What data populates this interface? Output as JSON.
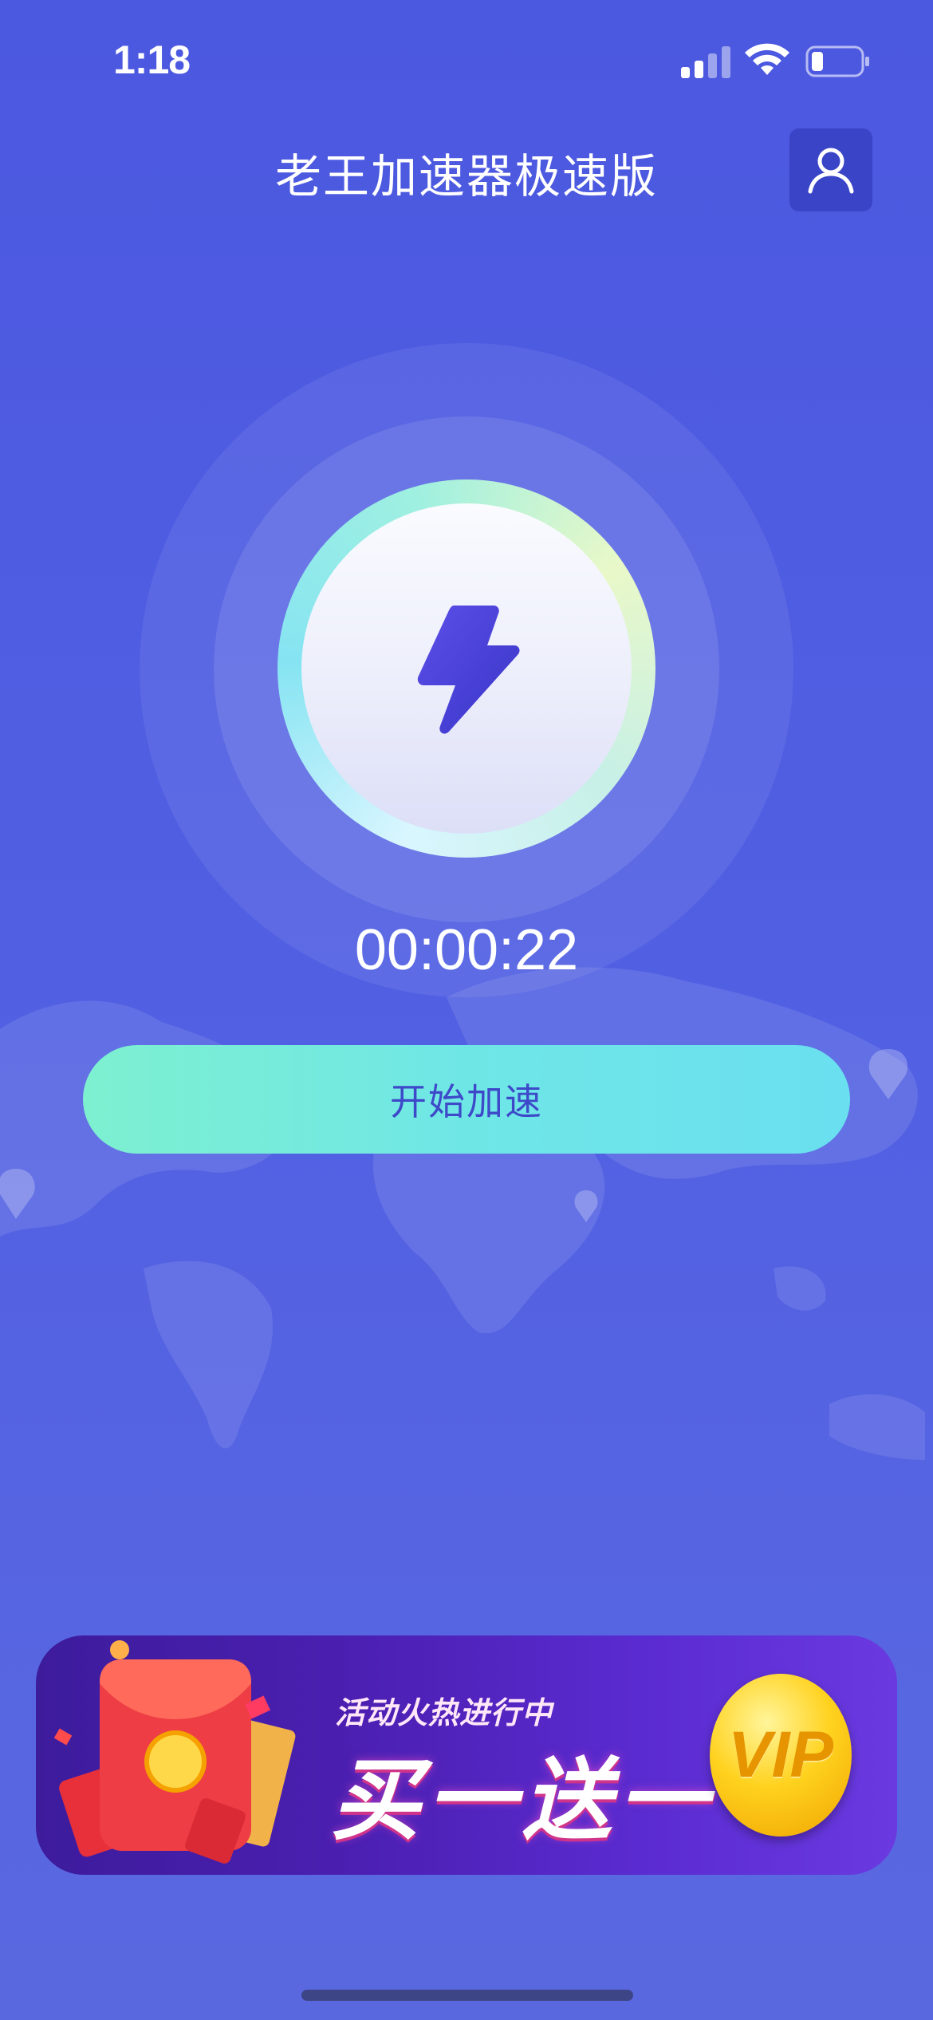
{
  "status_bar": {
    "time": "1:18"
  },
  "header": {
    "title": "老王加速器极速版",
    "profile_icon": "user-icon"
  },
  "accelerator": {
    "icon": "lightning-bolt-icon",
    "timer": "00:00:22",
    "start_label": "开始加速"
  },
  "promo": {
    "subtitle": "活动火热进行中",
    "title": "买一送一",
    "badge": "VIP"
  },
  "colors": {
    "background": "#4b58e0",
    "profile_button": "#3a44c7",
    "start_button_gradient": [
      "#7df0d0",
      "#6adff0"
    ],
    "start_label": "#3d49c9",
    "bolt": "#4a3fd6"
  }
}
